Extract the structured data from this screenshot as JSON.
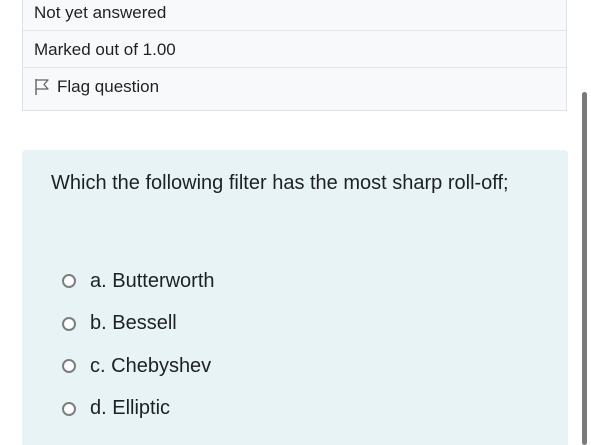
{
  "question_info": {
    "state": "Not yet answered",
    "grade": "Marked out of 1.00",
    "flag_label": "Flag question",
    "flag_icon": "flag-icon"
  },
  "question": {
    "text": "Which the following filter has the most sharp roll-off;",
    "answers": [
      {
        "letter": "a.",
        "text": "Butterworth",
        "selected": false
      },
      {
        "letter": "b.",
        "text": "Bessell",
        "selected": false
      },
      {
        "letter": "c.",
        "text": "Chebyshev",
        "selected": false
      },
      {
        "letter": "d.",
        "text": "Elliptic",
        "selected": false
      }
    ]
  },
  "colors": {
    "info_background": "#f8f9fa",
    "question_background": "#e7f3f5",
    "text": "#1d2125",
    "radio_border": "#7b7e82"
  }
}
